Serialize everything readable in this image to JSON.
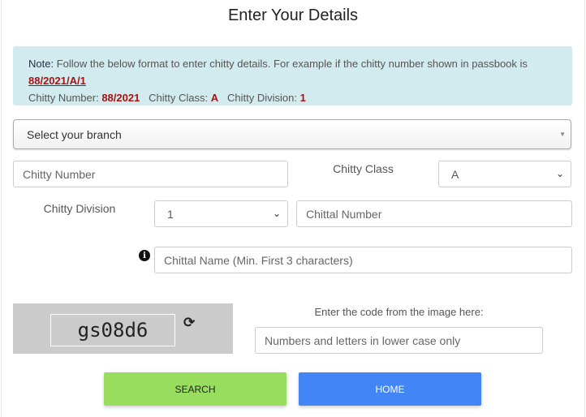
{
  "title": "Enter Your Details",
  "note": {
    "label": "Note:",
    "text": " Follow the below format to enter chitty details. For example if the chitty number shown in passbook is ",
    "example": "88/2021/A/1",
    "number_label": "Chitty Number:",
    "number_value": "88/2021",
    "class_label": "Chitty Class:",
    "class_value": "A",
    "division_label": "Chitty Division:",
    "division_value": "1"
  },
  "branch": {
    "placeholder": "Select your branch"
  },
  "chitty_number": {
    "placeholder": "Chitty Number"
  },
  "chitty_class": {
    "label": "Chitty Class",
    "value": "A"
  },
  "chitty_division": {
    "label": "Chitty Division",
    "value": "1"
  },
  "chittal_number": {
    "placeholder": "Chittal Number"
  },
  "chittal_name": {
    "placeholder": "Chittal Name (Min. First 3 characters)"
  },
  "captcha": {
    "code": "gs08d6",
    "prompt": "Enter the code from the image here:",
    "placeholder": "Numbers and letters in lower case only"
  },
  "buttons": {
    "search": "SEARCH",
    "home": "HOME"
  },
  "colors": {
    "search": "#98dd5d",
    "home": "#4285f4",
    "note_bg": "#d1ebef",
    "highlight": "#a11111"
  }
}
